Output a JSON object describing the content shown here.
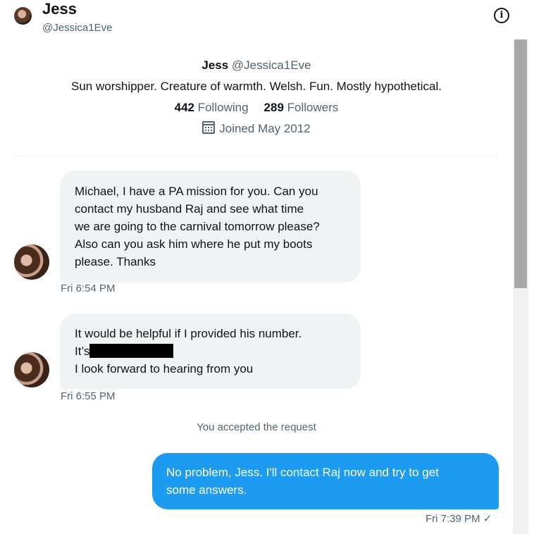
{
  "header": {
    "name": "Jess",
    "handle": "@Jessica1Eve",
    "info_icon": "info-icon"
  },
  "profile": {
    "name": "Jess",
    "handle": "@Jessica1Eve",
    "bio": "Sun worshipper. Creature of warmth. Welsh. Fun. Mostly hypothetical.",
    "following_count": "442",
    "following_label": "Following",
    "followers_count": "289",
    "followers_label": "Followers",
    "joined": "Joined May 2012",
    "joined_icon": "calendar-icon"
  },
  "messages": [
    {
      "lines": [
        "Michael, I have a PA mission for you. Can you",
        "contact my husband Raj and see what time",
        "we are going to the carnival tomorrow please?",
        "Also can you ask him where he put my boots",
        "please. Thanks"
      ],
      "time": "Fri 6:54 PM"
    },
    {
      "lines": [
        "It would be helpful if I provided his number.",
        "It’s",
        "I look forward to hearing from you"
      ],
      "time": "Fri 6:55 PM"
    }
  ],
  "system_note": "You accepted the request",
  "reply": {
    "lines": [
      "No problem, Jess. I'll contact Raj now and try to get",
      "some answers."
    ],
    "time": "Fri 7:39 PM",
    "status_glyph": "✓"
  },
  "colors": {
    "accent": "#1d9bf0",
    "bubble_in": "#eff3f4",
    "muted_text": "#536471"
  }
}
